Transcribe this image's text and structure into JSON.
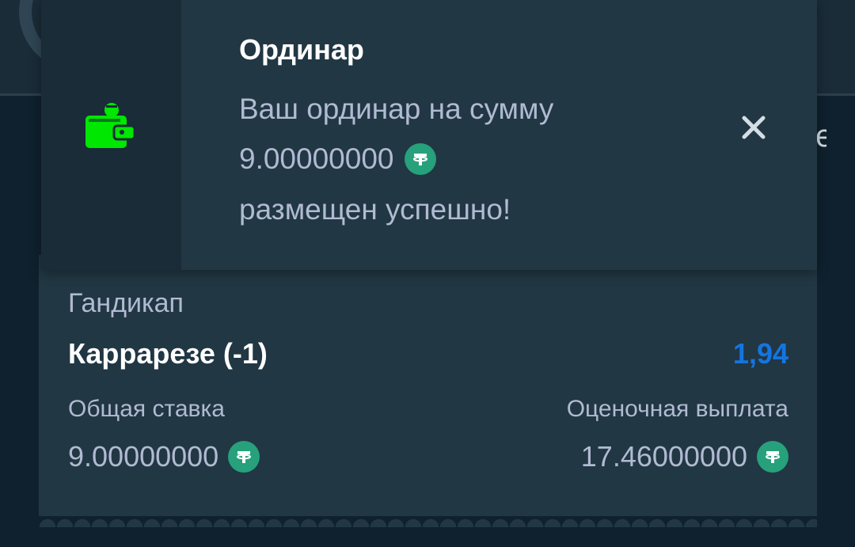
{
  "background": {
    "right_glyph": "e"
  },
  "toast": {
    "title": "Ординар",
    "message_line1": "Ваш ординар на сумму",
    "amount": "9.00000000",
    "message_line3": "размещен успешно!",
    "icon": "wallet-icon",
    "currency_icon": "usdt-icon",
    "close_icon": "close-icon"
  },
  "bet_card": {
    "market": "Гандикап",
    "selection": "Каррарезе (-1)",
    "odds": "1,94",
    "total_stake_label": "Общая ставка",
    "total_stake_value": "9.00000000",
    "estimated_payout_label": "Оценочная выплата",
    "estimated_payout_value": "17.46000000",
    "currency_icon": "usdt-icon"
  },
  "colors": {
    "background": "#0f212e",
    "card": "#213743",
    "odds": "#1475e1",
    "wallet_icon": "#00e701",
    "usdt": "#26a17b"
  }
}
